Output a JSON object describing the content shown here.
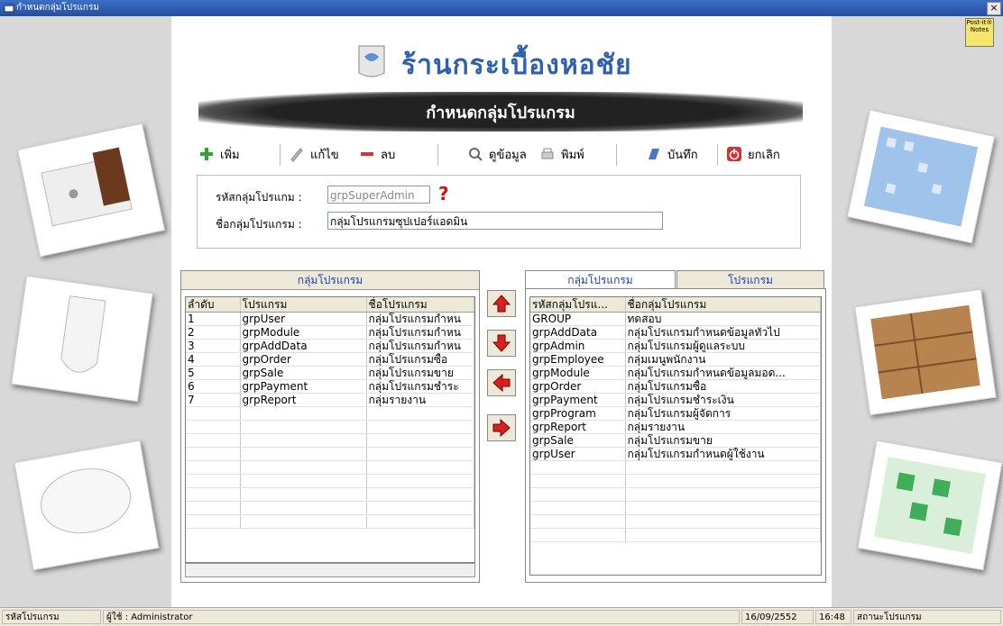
{
  "window": {
    "title": "กำหนดกลุ่มโปรแกรม",
    "close_label": "×"
  },
  "postit": {
    "label": "Post-it® Notes"
  },
  "logo": {
    "text": "ร้านกระเบื้องหอชัย"
  },
  "banner": {
    "title": "กำหนดกลุ่มโปรแกรม"
  },
  "toolbar": {
    "add": "เพิ่ม",
    "edit": "แก้ไข",
    "delete": "ลบ",
    "view": "ดูข้อมูล",
    "print": "พิมพ์",
    "save": "บันทึก",
    "cancel": "ยกเลิก"
  },
  "form": {
    "code_label": "รหัสกลุ่มโปรแกม :",
    "code_value": "grpSuperAdmin",
    "name_label": "ชื่อกลุ่มโปรแกรม :",
    "name_value": "กลุ่มโปรแกรมซุปเปอร์แอดมิน"
  },
  "left_panel": {
    "title": "กลุ่มโปรแกรม",
    "columns": [
      "ลำดับ",
      "โปรแกรม",
      "ชื่อโปรแกรม"
    ],
    "rows": [
      [
        "1",
        "grpUser",
        "กลุ่มโปรแกรมกำหน"
      ],
      [
        "2",
        "grpModule",
        "กลุ่มโปรแกรมกำหน"
      ],
      [
        "3",
        "grpAddData",
        "กลุ่มโปรแกรมกำหน"
      ],
      [
        "4",
        "grpOrder",
        "กลุ่มโปรแกรมซื้อ"
      ],
      [
        "5",
        "grpSale",
        "กลุ่มโปรแกรมขาย"
      ],
      [
        "6",
        "grpPayment",
        "กลุ่มโปรแกรมชำระ"
      ],
      [
        "7",
        "grpReport",
        "กลุ่มรายงาน"
      ]
    ]
  },
  "right_panel": {
    "tabs": [
      "กลุ่มโปรแกรม",
      "โปรแกรม"
    ],
    "columns": [
      "รหัสกลุ่มโปรแ...",
      "ชื่อกลุ่มโปรแกรม"
    ],
    "rows": [
      [
        "GROUP",
        "ทดสอบ"
      ],
      [
        "grpAddData",
        "กลุ่มโปรแกรมกำหนดข้อมูลทั่วไป"
      ],
      [
        "grpAdmin",
        "กลุ่มโปรแกรมผู้ดูแลระบบ"
      ],
      [
        "grpEmployee",
        "กลุ่มเมนูพนักงาน"
      ],
      [
        "grpModule",
        "กลุ่มโปรแกรมกำหนดข้อมูลมอด..."
      ],
      [
        "grpOrder",
        "กลุ่มโปรแกรมซื้อ"
      ],
      [
        "grpPayment",
        "กลุ่มโปรแกรมชำระเงิน"
      ],
      [
        "grpProgram",
        "กลุ่มโปรแกรมผู้จัดการ"
      ],
      [
        "grpReport",
        "กลุ่มรายงาน"
      ],
      [
        "grpSale",
        "กลุ่มโปรแกรมขาย"
      ],
      [
        "grpUser",
        "กลุ่มโปรแกรมกำหนดผู้ใช้งาน"
      ]
    ]
  },
  "statusbar": {
    "program_code": "รหัสโปรแกรม",
    "user": "ผู้ใช้ : Administrator",
    "date": "16/09/2552",
    "time": "16:48",
    "status": "สถานะโปรแกรม"
  }
}
